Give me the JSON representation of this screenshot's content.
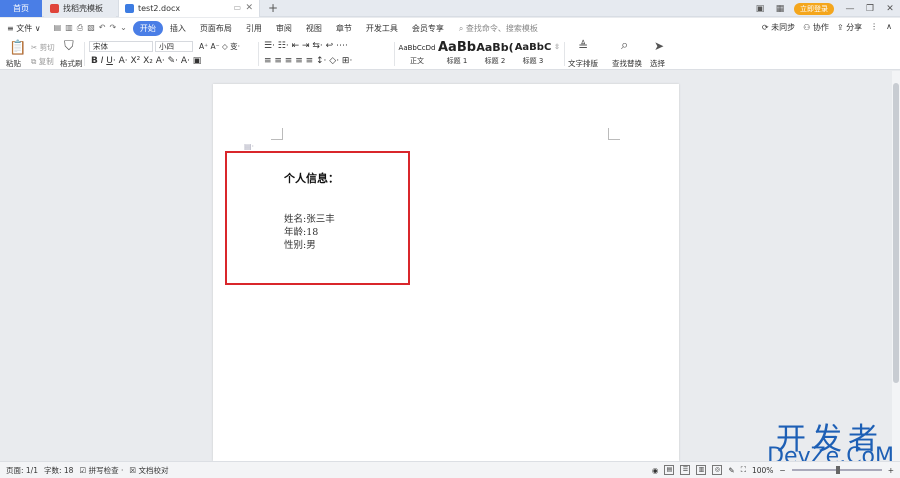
{
  "tabs": {
    "home": "首页",
    "templates": "找稻壳模板",
    "document": "test2.docx",
    "add": "+"
  },
  "window": {
    "login": "立即登录",
    "minimize": "—",
    "restore": "❐",
    "close": "✕"
  },
  "menu": {
    "file": "文件",
    "items": [
      "开始",
      "插入",
      "页面布局",
      "引用",
      "审阅",
      "视图",
      "章节",
      "开发工具",
      "会员专享"
    ],
    "search": "查找命令、搜索模板",
    "right": [
      "未同步",
      "协作",
      "分享"
    ]
  },
  "ribbon": {
    "paste": "粘贴",
    "cut": "剪切",
    "copy": "复制",
    "format_painter": "格式刷",
    "font_name": "宋体",
    "font_size": "小四",
    "styles": [
      {
        "sample": "AaBbCcDd",
        "label": "正文"
      },
      {
        "sample": "AaBb",
        "label": "标题 1"
      },
      {
        "sample": "AaBb(",
        "label": "标题 2"
      },
      {
        "sample": "AaBbC",
        "label": "标题 3"
      }
    ],
    "text_layout": "文字排版",
    "find_replace": "查找替换",
    "select": "选择"
  },
  "document": {
    "heading": "个人信息：",
    "lines": [
      "姓名:张三丰",
      "年龄:18",
      "性别:男"
    ]
  },
  "status": {
    "page": "页面: 1/1",
    "words": "字数: 18",
    "spell": "拼写检查",
    "proof": "文档校对",
    "zoom": "100%"
  },
  "watermark": {
    "top": "开发者",
    "bottom": "DevZe.CoM"
  },
  "colors": {
    "accent": "#4a7ee6",
    "highlight_border": "#d9262b",
    "login": "#f4a61c"
  }
}
